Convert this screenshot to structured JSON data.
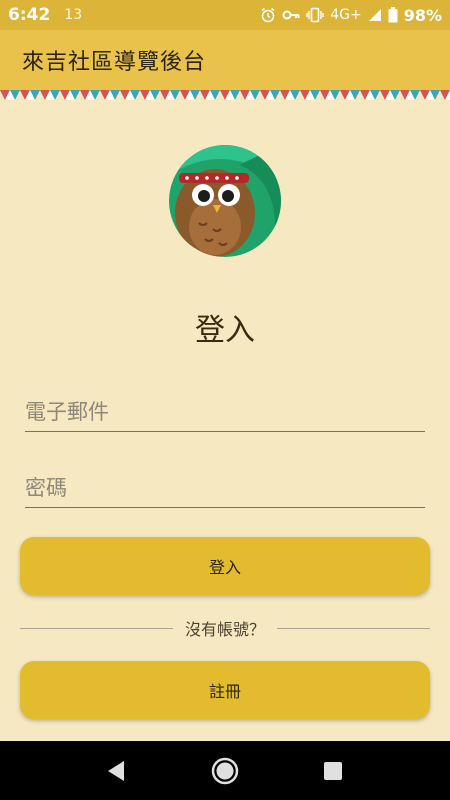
{
  "status_bar": {
    "time": "6:42",
    "extra": "13",
    "network": "4G+",
    "battery": "98%",
    "icons": [
      "alarm-icon",
      "vpn-key-icon",
      "vibrate-icon",
      "signal-icon",
      "battery-icon"
    ]
  },
  "app_bar": {
    "title": "來吉社區導覽後台"
  },
  "login": {
    "heading": "登入",
    "email_placeholder": "電子郵件",
    "email_value": "",
    "password_placeholder": "密碼",
    "password_value": "",
    "login_button": "登入",
    "no_account_text": "沒有帳號？",
    "register_button": "註冊"
  },
  "nav_bar": {
    "icons": [
      "back-icon",
      "home-icon",
      "recent-apps-icon"
    ]
  },
  "colors": {
    "status_bar": "#dcb538",
    "app_bar": "#e8c24a",
    "background": "#f6e9c1",
    "button": "#e3bb2e",
    "zigzag_red": "#d9534f",
    "zigzag_teal": "#3aa7b8"
  }
}
